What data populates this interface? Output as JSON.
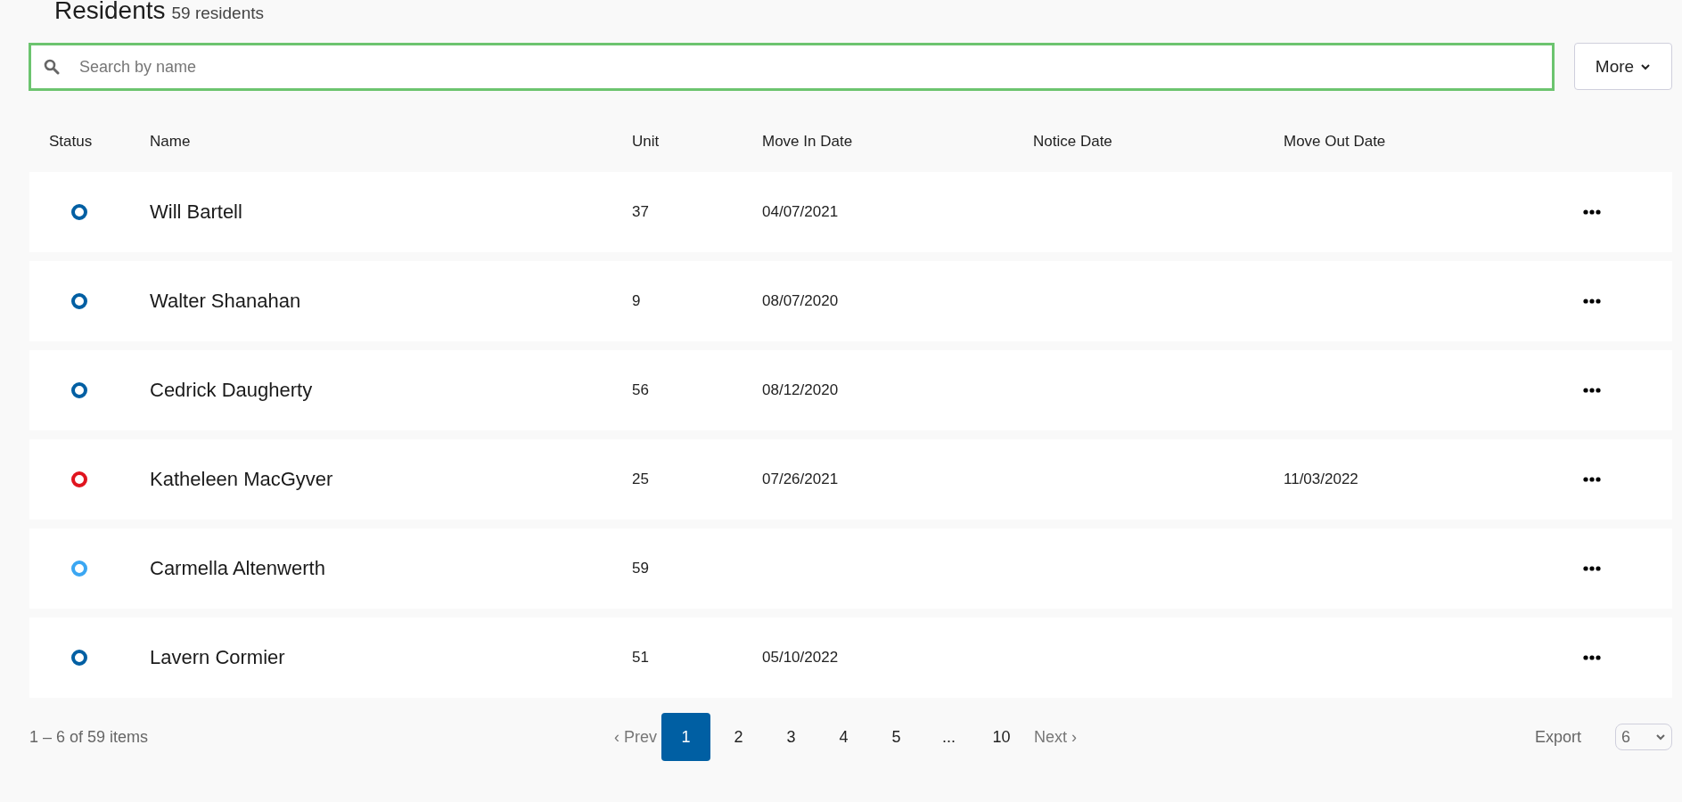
{
  "header": {
    "title": "Residents",
    "count": "59 residents"
  },
  "search": {
    "placeholder": "Search by name"
  },
  "more_button": "More",
  "table": {
    "columns": [
      "Status",
      "Name",
      "Unit",
      "Move In Date",
      "Notice Date",
      "Move Out Date"
    ],
    "rows": [
      {
        "color": "#005fa3",
        "name": "Will Bartell",
        "unit": "37",
        "move_in": "04/07/2021",
        "move_out": ""
      },
      {
        "color": "#005fa3",
        "name": "Walter Shanahan",
        "unit": "9",
        "move_in": "08/07/2020",
        "move_out": ""
      },
      {
        "color": "#005fa3",
        "name": "Cedrick Daugherty",
        "unit": "56",
        "move_in": "08/12/2020",
        "move_out": ""
      },
      {
        "color": "#e0141e",
        "name": "Katheleen MacGyver",
        "unit": "25",
        "move_in": "07/26/2021",
        "move_out": "11/03/2022"
      },
      {
        "color": "#3aa6f2",
        "name": "Carmella Altenwerth",
        "unit": "59",
        "move_in": "",
        "move_out": ""
      },
      {
        "color": "#005fa3",
        "name": "Lavern Cormier",
        "unit": "51",
        "move_in": "05/10/2022",
        "move_out": ""
      }
    ]
  },
  "footer": {
    "summary": "1 – 6 of 59 items",
    "prev": "‹ Prev",
    "next": "Next ›",
    "pages": [
      {
        "label": "1",
        "selected": true
      },
      {
        "label": "2",
        "selected": false
      },
      {
        "label": "3",
        "selected": false
      },
      {
        "label": "4",
        "selected": false
      },
      {
        "label": "5",
        "selected": false
      },
      {
        "label": "...",
        "selected": false
      },
      {
        "label": "10",
        "selected": false
      }
    ],
    "export": "Export",
    "page_size": "6"
  }
}
